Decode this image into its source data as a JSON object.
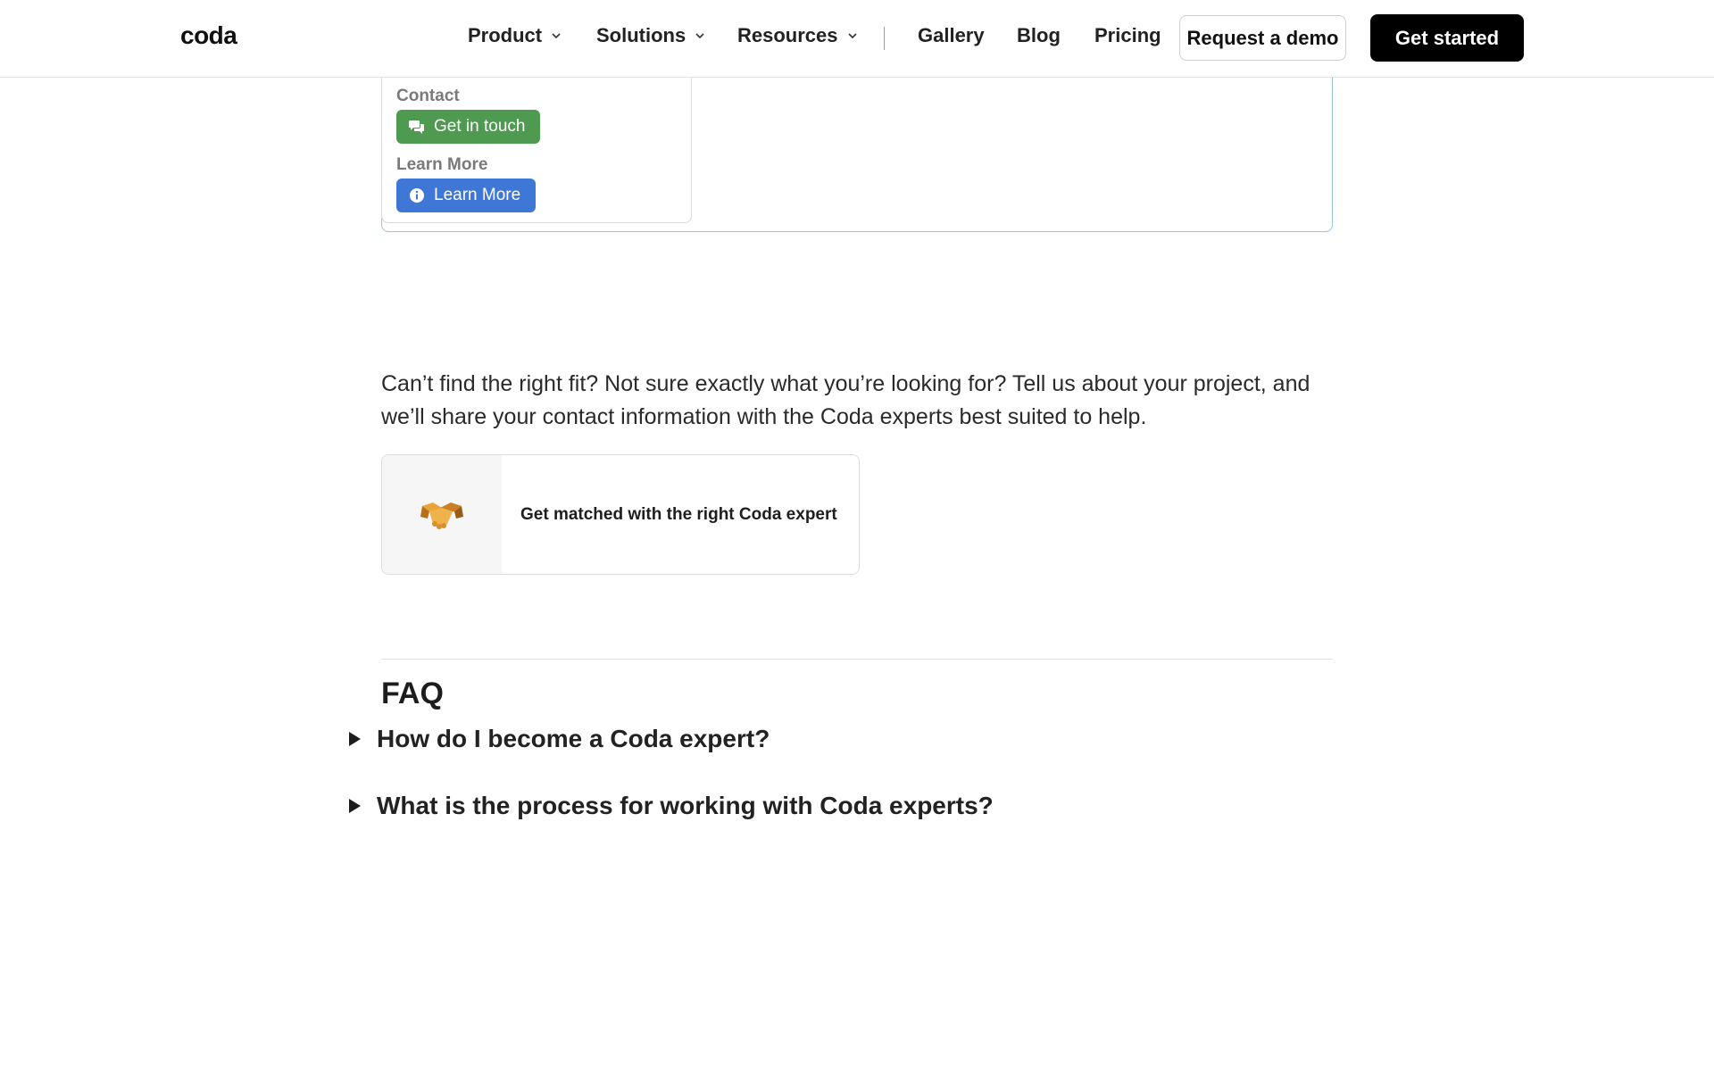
{
  "nav": {
    "logo": "coda",
    "items": [
      {
        "label": "Product",
        "dropdown": true
      },
      {
        "label": "Solutions",
        "dropdown": true
      },
      {
        "label": "Resources",
        "dropdown": true
      }
    ],
    "links": [
      "Gallery",
      "Blog",
      "Pricing"
    ],
    "demo_label": "Request a demo",
    "start_label": "Get started"
  },
  "embed": {
    "contact_label": "Contact",
    "contact_button": "Get in touch",
    "learn_label": "Learn More",
    "learn_button": "Learn More",
    "colors": {
      "green": "#4e9a51",
      "blue": "#3f77d6"
    }
  },
  "intro": {
    "text": "Can’t find the right fit? Not sure exactly what you’re looking for? Tell us about your project, and we’ll share your contact information with the Coda experts best suited to help."
  },
  "match_card": {
    "icon": "handshake-icon",
    "label": "Get matched with the right Coda expert"
  },
  "faq": {
    "title": "FAQ",
    "questions": [
      "How do I become a Coda expert?",
      "What is the process for working with Coda experts?"
    ]
  }
}
